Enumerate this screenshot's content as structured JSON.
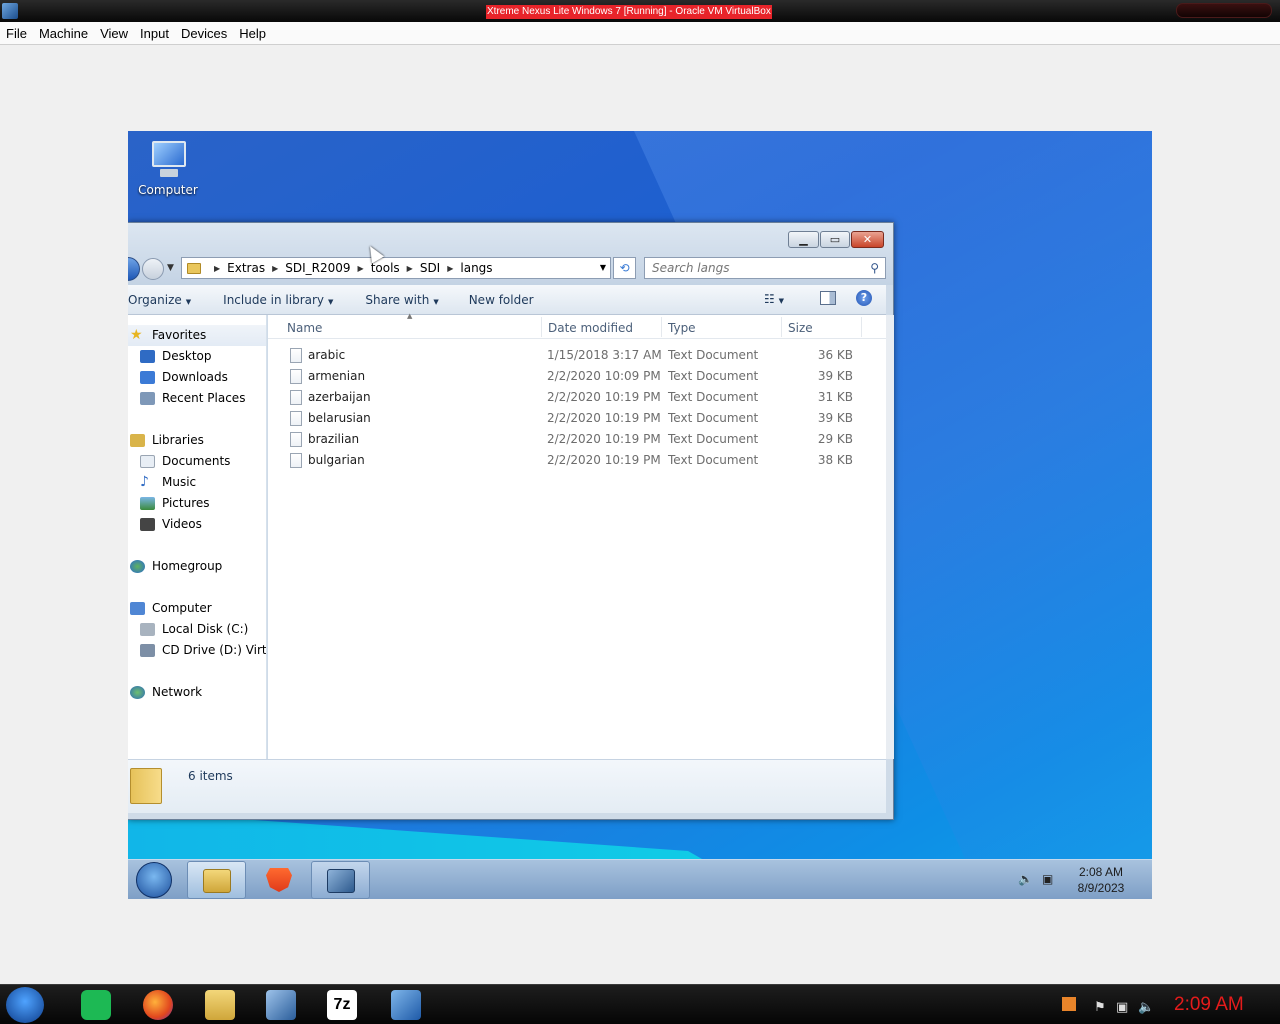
{
  "host": {
    "title": "Xtreme Nexus Lite Windows 7 [Running] - Oracle VM VirtualBox",
    "menu": [
      "File",
      "Machine",
      "View",
      "Input",
      "Devices",
      "Help"
    ],
    "clock": "2:09 AM"
  },
  "desktop": {
    "icon_label": "Computer"
  },
  "explorer": {
    "breadcrumb": [
      "Extras",
      "SDI_R2009",
      "tools",
      "SDI",
      "langs"
    ],
    "search_placeholder": "Search langs",
    "toolbar": {
      "organize": "Organize",
      "include": "Include in library",
      "share": "Share with",
      "newfolder": "New folder"
    },
    "nav": {
      "favorites": "Favorites",
      "desktop": "Desktop",
      "downloads": "Downloads",
      "recent": "Recent Places",
      "libraries": "Libraries",
      "documents": "Documents",
      "music": "Music",
      "pictures": "Pictures",
      "videos": "Videos",
      "homegroup": "Homegroup",
      "computer": "Computer",
      "localdisk": "Local Disk (C:)",
      "cddrive": "CD Drive (D:) Virtual",
      "network": "Network"
    },
    "columns": {
      "name": "Name",
      "date": "Date modified",
      "type": "Type",
      "size": "Size"
    },
    "files": [
      {
        "name": "arabic",
        "date": "1/15/2018 3:17 AM",
        "type": "Text Document",
        "size": "36 KB"
      },
      {
        "name": "armenian",
        "date": "2/2/2020 10:09 PM",
        "type": "Text Document",
        "size": "39 KB"
      },
      {
        "name": "azerbaijan",
        "date": "2/2/2020 10:19 PM",
        "type": "Text Document",
        "size": "31 KB"
      },
      {
        "name": "belarusian",
        "date": "2/2/2020 10:19 PM",
        "type": "Text Document",
        "size": "39 KB"
      },
      {
        "name": "brazilian",
        "date": "2/2/2020 10:19 PM",
        "type": "Text Document",
        "size": "29 KB"
      },
      {
        "name": "bulgarian",
        "date": "2/2/2020 10:19 PM",
        "type": "Text Document",
        "size": "38 KB"
      }
    ],
    "item_count": "6 items"
  },
  "vm_taskbar": {
    "time": "2:08 AM",
    "date": "8/9/2023"
  }
}
